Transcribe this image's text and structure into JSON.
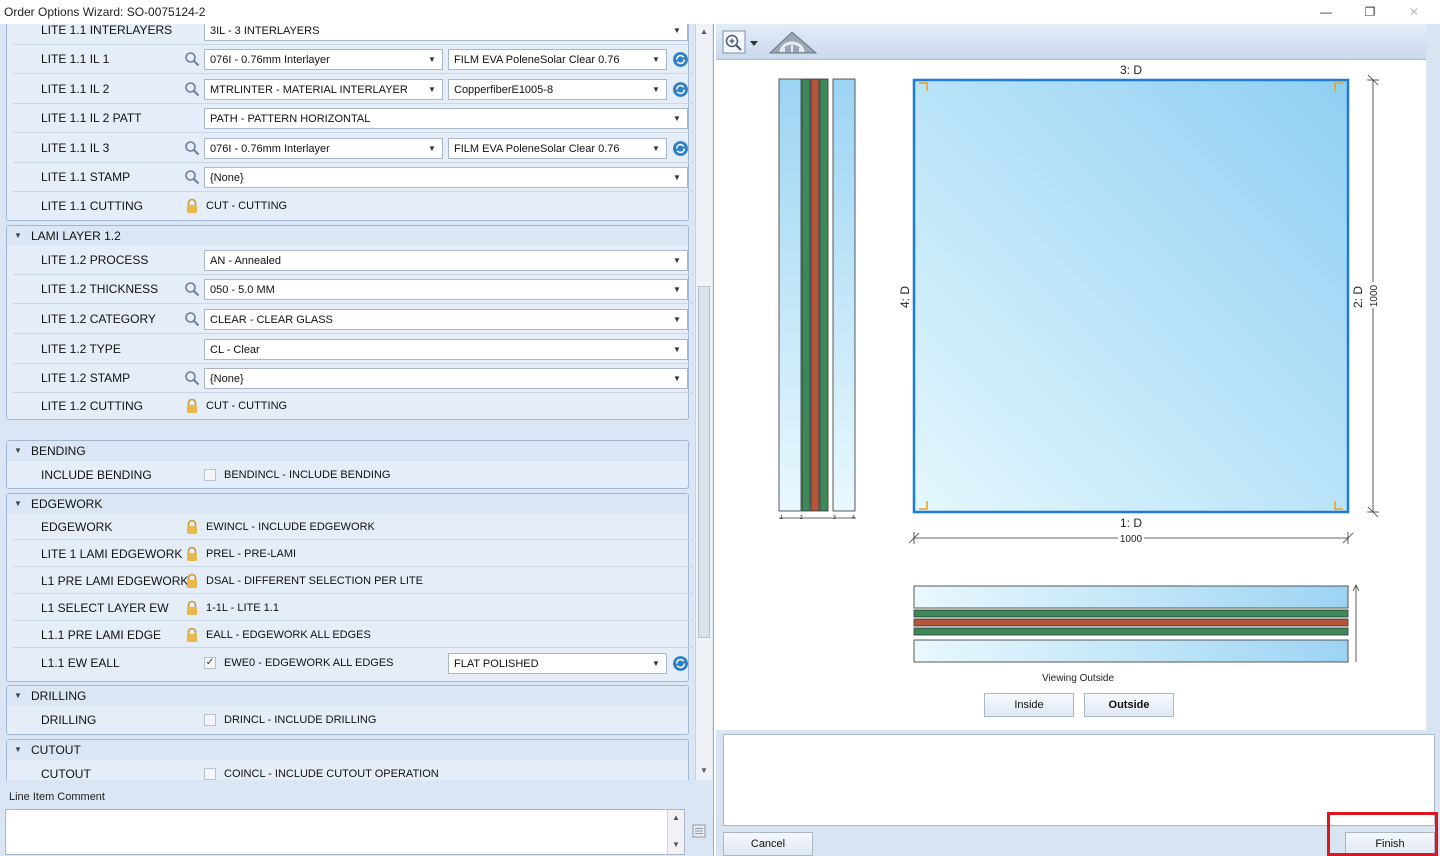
{
  "window": {
    "title": "Order Options Wizard: SO-0075124-2",
    "minimize": "—",
    "restore": "❐",
    "close": "✕"
  },
  "groups": {
    "lami_layer_1_1": {
      "rows": [
        {
          "label": "LITE 1.1 INTERLAYERS",
          "combo": "3IL - 3 INTERLAYERS"
        },
        {
          "label": "LITE 1.1 IL 1",
          "combo": "076I - 0.76mm Interlayer",
          "combo2": "FILM EVA PoleneSolar Clear 0.76"
        },
        {
          "label": "LITE 1.1 IL 2",
          "combo": "MTRLINTER - MATERIAL INTERLAYER",
          "combo2": "CopperfiberE1005-8"
        },
        {
          "label": "LITE 1.1 IL 2 PATT",
          "combo": "PATH - PATTERN HORIZONTAL"
        },
        {
          "label": "LITE 1.1 IL 3",
          "combo": "076I - 0.76mm Interlayer",
          "combo2": "FILM EVA PoleneSolar Clear 0.76"
        },
        {
          "label": "LITE 1.1 STAMP",
          "combo": "{None}"
        },
        {
          "label": "LITE 1.1 CUTTING",
          "value": "CUT - CUTTING"
        }
      ]
    },
    "lami_layer_1_2": {
      "title": "LAMI LAYER 1.2",
      "rows": [
        {
          "label": "LITE 1.2 PROCESS",
          "combo": "AN - Annealed"
        },
        {
          "label": "LITE 1.2 THICKNESS",
          "combo": "050 - 5.0 MM"
        },
        {
          "label": "LITE 1.2 CATEGORY",
          "combo": "CLEAR - CLEAR GLASS"
        },
        {
          "label": "LITE 1.2 TYPE",
          "combo": "CL - Clear"
        },
        {
          "label": "LITE 1.2 STAMP",
          "combo": "{None}"
        },
        {
          "label": "LITE 1.2 CUTTING",
          "value": "CUT - CUTTING"
        }
      ]
    },
    "bending": {
      "title": "BENDING",
      "rows": [
        {
          "label": "INCLUDE BENDING",
          "check": "BENDINCL - INCLUDE BENDING",
          "checked": ""
        }
      ]
    },
    "edgework": {
      "title": "EDGEWORK",
      "rows": [
        {
          "label": "EDGEWORK",
          "value": "EWINCL - INCLUDE EDGEWORK"
        },
        {
          "label": "LITE 1 LAMI EDGEWORK",
          "value": "PREL - PRE-LAMI"
        },
        {
          "label": "L1 PRE LAMI EDGEWORK",
          "value": "DSAL - DIFFERENT SELECTION PER LITE"
        },
        {
          "label": "L1 SELECT LAYER EW",
          "value": "1-1L - LITE 1.1"
        },
        {
          "label": "L1.1 PRE LAMI EDGE",
          "value": "EALL - EDGEWORK ALL EDGES"
        },
        {
          "label": "L1.1 EW EALL",
          "check": "EWE0 - EDGEWORK ALL EDGES",
          "checked": "✓",
          "combo2": "FLAT POLISHED"
        }
      ]
    },
    "drilling": {
      "title": "DRILLING",
      "rows": [
        {
          "label": "DRILLING",
          "check": "DRINCL - INCLUDE DRILLING",
          "checked": ""
        }
      ]
    },
    "cutout": {
      "title": "CUTOUT",
      "rows": [
        {
          "label": "CUTOUT",
          "check": "COINCL - INCLUDE CUTOUT OPERATION",
          "checked": ""
        }
      ]
    }
  },
  "comment": {
    "label": "Line Item Comment",
    "value": ""
  },
  "preview": {
    "edge_top": "3: D",
    "edge_right": "2: D",
    "edge_bottom": "1: D",
    "edge_left": "4: D",
    "width_dim": "1000",
    "height_dim": "1000",
    "layer_ticks": [
      "1",
      "2",
      "3",
      "4"
    ],
    "viewing_caption": "Viewing Outside",
    "inside_button": "Inside",
    "outside_button": "Outside",
    "colors": {
      "glass": "#bfe7fb",
      "green_layer": "#3c8a5a",
      "copper_layer": "#b5563a",
      "frame_blue": "#1e7bd6",
      "corner_marker": "#e6a11e"
    }
  },
  "footer": {
    "cancel": "Cancel",
    "finish": "Finish",
    "highlight_color": "#e0141e"
  }
}
